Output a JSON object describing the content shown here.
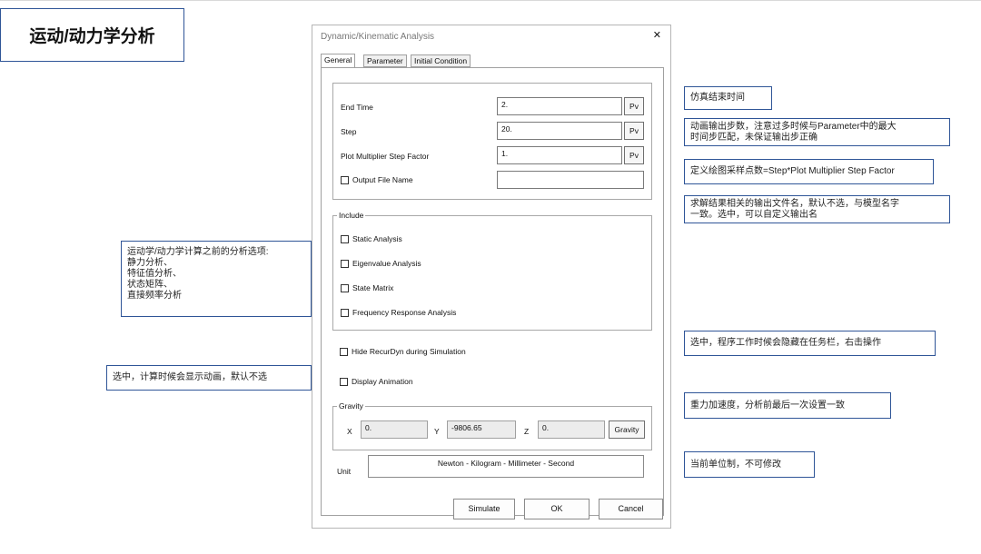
{
  "slide_title": "运动/动力学分析",
  "dialog": {
    "title": "Dynamic/Kinematic Analysis",
    "close_glyph": "✕",
    "tabs": [
      "General",
      "Parameter",
      "Initial Condition"
    ],
    "active_tab": "General",
    "fields": {
      "end_time": {
        "label": "End Time",
        "value": "2.",
        "button": "Pv"
      },
      "step": {
        "label": "Step",
        "value": "20.",
        "button": "Pv"
      },
      "plot_multiplier": {
        "label": "Plot Multiplier Step Factor",
        "value": "1.",
        "button": "Pv"
      },
      "output_file": {
        "label": "Output File Name",
        "value": "",
        "checked": false
      }
    },
    "include": {
      "title": "Include",
      "items": [
        {
          "label": "Static Analysis",
          "checked": false
        },
        {
          "label": "Eigenvalue Analysis",
          "checked": false
        },
        {
          "label": "State Matrix",
          "checked": false
        },
        {
          "label": "Frequency Response Analysis",
          "checked": false
        }
      ]
    },
    "hide_recurdyn": {
      "label": "Hide RecurDyn during Simulation",
      "checked": false
    },
    "display_animation": {
      "label": "Display Animation",
      "checked": false
    },
    "gravity": {
      "title": "Gravity",
      "x_label": "X",
      "x_value": "0.",
      "y_label": "Y",
      "y_value": "-9806.65",
      "z_label": "Z",
      "z_value": "0.",
      "button": "Gravity"
    },
    "unit": {
      "label": "Unit",
      "value": "Newton - Kilogram - Millimeter - Second"
    },
    "buttons": {
      "simulate": "Simulate",
      "ok": "OK",
      "cancel": "Cancel"
    }
  },
  "notes": {
    "end_time": "仿真结束时间",
    "step": [
      "动画输出步数，注意过多时候与Parameter中的最大",
      "时间步匹配，未保证输出步正确"
    ],
    "plot_factor": "定义绘图采样点数=Step*Plot Multiplier Step Factor",
    "output_file": [
      "求解结果相关的输出文件名，默认不选，与模型名字",
      "一致。选中，可以自定义输出名"
    ],
    "include": [
      "运动学/动力学计算之前的分析选项:",
      "静力分析、",
      "特征值分析、",
      "状态矩阵、",
      "直接频率分析"
    ],
    "hide": "选中，程序工作时候会隐藏在任务栏，右击操作",
    "animation": "选中，计算时候会显示动画，默认不选",
    "gravity": "重力加速度，分析前最后一次设置一致",
    "unit": "当前单位制，不可修改"
  }
}
